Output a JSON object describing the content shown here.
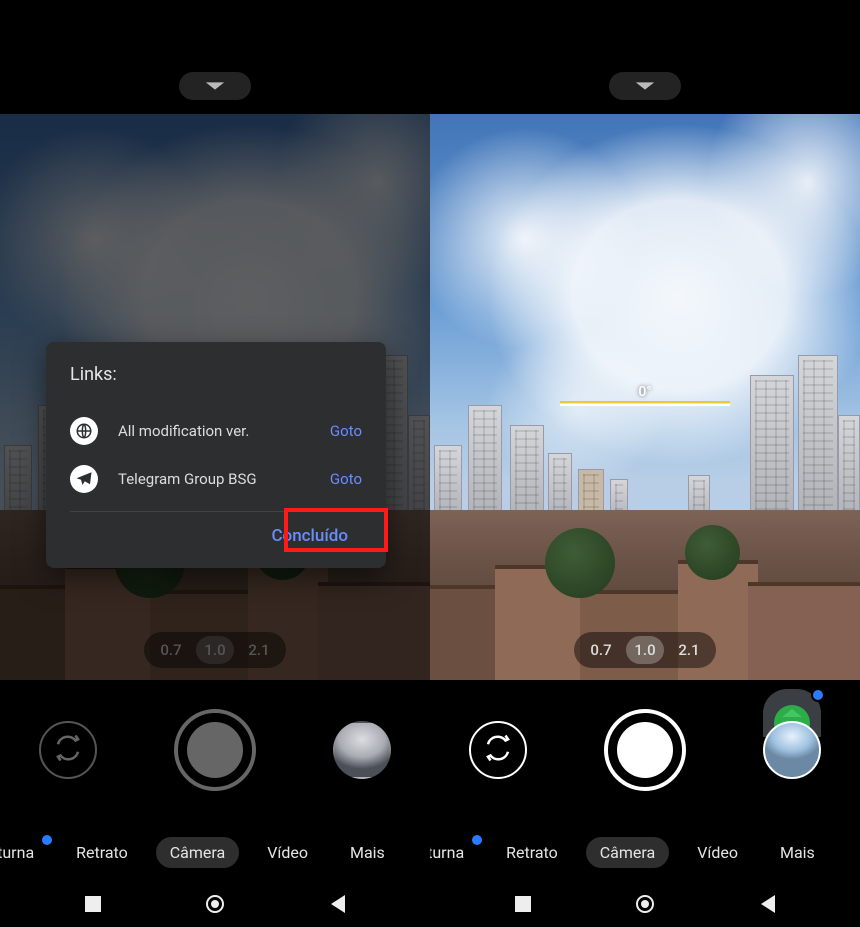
{
  "left": {
    "zoom": {
      "options": [
        "0.7",
        "1.0",
        "2.1"
      ],
      "selected": "1.0"
    },
    "modes": [
      "oturna",
      "Retrato",
      "Câmera",
      "Vídeo",
      "Mais"
    ],
    "mode_selected": "Câmera",
    "dialog": {
      "title": "Links:",
      "items": [
        {
          "label": "All modification ver.",
          "action": "Goto",
          "icon": "globe"
        },
        {
          "label": "Telegram Group BSG",
          "action": "Goto",
          "icon": "telegram"
        }
      ],
      "done": "Concluído"
    }
  },
  "right": {
    "level_angle": "0°",
    "zoom": {
      "options": [
        "0.7",
        "1.0",
        "2.1"
      ],
      "selected": "1.0"
    },
    "modes": [
      "oturna",
      "Retrato",
      "Câmera",
      "Vídeo",
      "Mais"
    ],
    "mode_selected": "Câmera"
  }
}
